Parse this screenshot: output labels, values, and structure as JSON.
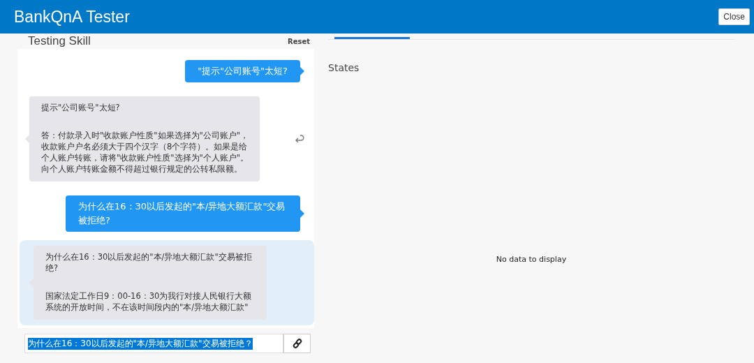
{
  "window": {
    "title": "BankQnA Tester",
    "close_button": "Close"
  },
  "left_panel": {
    "title": "Testing Skill",
    "reset": "Reset"
  },
  "messages": [
    {
      "kind": "user",
      "text": "\"提示\"公司账号\"太短?",
      "highlighted": false
    },
    {
      "kind": "bot",
      "question": "提示\"公司账号\"太短?",
      "answer": "答：付款录入时\"收款账户性质\"如果选择为\"公司账户\"，收款账户户名必须大于四个汉字（8个字符）。如果是给个人账户转账，请将\"收款账户性质\"选择为\"个人账户\"。向个人账户转账金额不得超过银行规定的公转私限额。",
      "highlighted": false,
      "reply_icon": true
    },
    {
      "kind": "user",
      "text": "为什么在16：30以后发起的\"本/异地大额汇款\"交易被拒绝?",
      "highlighted": false
    },
    {
      "kind": "bot",
      "question": "为什么在16：30以后发起的\"本/异地大额汇款\"交易被拒绝?",
      "answer": "国家法定工作日9：00-16：30为我行对接人民银行大额系统的开放时间，不在该时间段内的\"本/异地大额汇款\"",
      "highlighted": true,
      "reply_icon": false
    }
  ],
  "input": {
    "value": "为什么在16：30以后发起的\"本/异地大额汇款\"交易被拒绝？",
    "text_selected": true
  },
  "right_panel": {
    "heading": "States",
    "empty_message": "No data to display"
  }
}
